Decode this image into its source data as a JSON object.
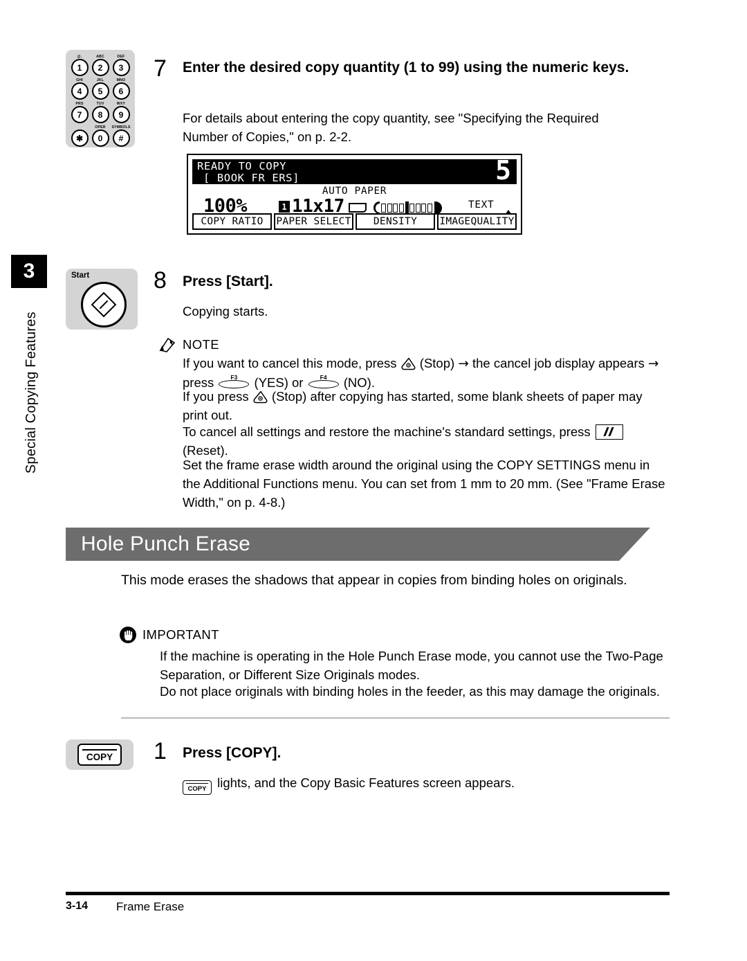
{
  "sidebar": {
    "chapter_number": "3",
    "chapter_title": "Special Copying Features"
  },
  "keypad": {
    "keys": [
      {
        "digit": "1",
        "letters": "@."
      },
      {
        "digit": "2",
        "letters": "ABC"
      },
      {
        "digit": "3",
        "letters": "DEF"
      },
      {
        "digit": "4",
        "letters": "GHI"
      },
      {
        "digit": "5",
        "letters": "JKL"
      },
      {
        "digit": "6",
        "letters": "MNO"
      },
      {
        "digit": "7",
        "letters": "PRS"
      },
      {
        "digit": "8",
        "letters": "TUV"
      },
      {
        "digit": "9",
        "letters": "WXY"
      },
      {
        "digit": "✱",
        "letters": ""
      },
      {
        "digit": "0",
        "letters": "OPER"
      },
      {
        "digit": "#",
        "letters": "SYMBOLS"
      }
    ]
  },
  "step7": {
    "number": "7",
    "heading": "Enter the desired copy quantity (1 to 99) using the numeric keys.",
    "body": "For details about entering the copy quantity, see \"Specifying the Required Number of Copies,\" on p. 2-2."
  },
  "lcd": {
    "line1": "READY TO COPY",
    "line2": "[ BOOK FR ERS]",
    "quantity": "5",
    "auto_paper": "AUTO PAPER",
    "copy_ratio_value": "100%",
    "cassette": "1",
    "paper_size": "11x17",
    "image_quality_value": "TEXT",
    "buttons": [
      "COPY RATIO",
      "PAPER SELECT",
      "DENSITY",
      "IMAGEQUALITY"
    ],
    "density_boxes": 9,
    "density_current_index": 4
  },
  "start_key": {
    "label": "Start"
  },
  "step8": {
    "number": "8",
    "heading": "Press [Start].",
    "body": "Copying starts."
  },
  "note": {
    "label": "NOTE",
    "p1_a": "If you want to cancel this mode, press",
    "p1_b": "(Stop)",
    "p1_arrow": "→",
    "p1_c": "the cancel job display appears",
    "p1_d": "press",
    "f3_label": "F3",
    "p1_yes": "(YES) or",
    "f4_label": "F4",
    "p1_no": "(NO).",
    "p2_a": "If you press",
    "p2_b": "(Stop) after copying has started, some blank sheets of paper may print out.",
    "p3_a": "To cancel all settings and restore the machine's standard settings, press",
    "p3_b": "(Reset).",
    "p4": "Set the frame erase width around the original using the COPY SETTINGS menu in the Additional Functions menu. You can set from 1 mm to 20 mm. (See \"Frame Erase Width,\" on p. 4-8.)"
  },
  "section": {
    "title": "Hole Punch Erase",
    "intro": "This mode erases the shadows that appear in copies from binding holes on originals."
  },
  "important": {
    "label": "IMPORTANT",
    "p1": "If the machine is operating in the Hole Punch Erase mode, you cannot use the Two-Page Separation, or Different Size Originals modes.",
    "p2": "Do not place originals with binding holes in the feeder, as this may damage the originals."
  },
  "copy_key": {
    "label": "COPY"
  },
  "step1": {
    "number": "1",
    "heading": "Press [COPY].",
    "body_after_icon": "lights, and the Copy Basic Features screen appears."
  },
  "footer": {
    "page_number": "3-14",
    "section_name": "Frame Erase"
  },
  "colors": {
    "banner": "#6d6d6d",
    "key_background": "#d4d4d4",
    "tab_background": "#000000"
  }
}
